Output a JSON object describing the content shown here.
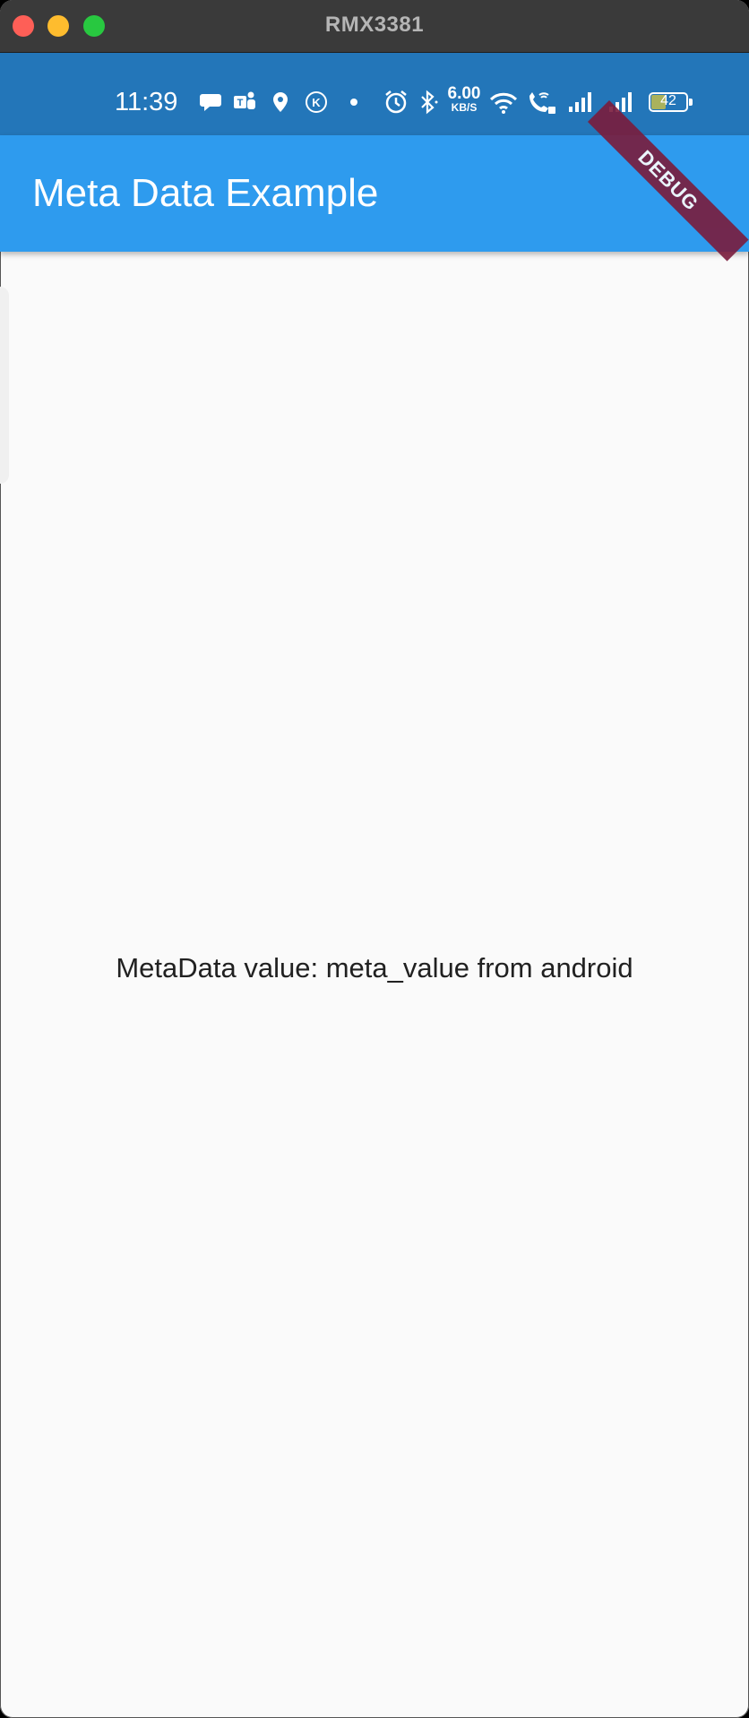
{
  "window": {
    "title": "RMX3381"
  },
  "status_bar": {
    "time": "11:39",
    "net_speed_value": "6.00",
    "net_speed_unit": "KB/S",
    "battery_level": "42",
    "icons": [
      "chat-bubble-icon",
      "teams-icon",
      "location-pin-icon",
      "k-circle-icon",
      "dot-icon",
      "alarm-icon",
      "bluetooth-icon",
      "wifi-icon",
      "wifi-call-icon",
      "signal-icon",
      "signal-icon",
      "battery-icon"
    ]
  },
  "debug_banner": {
    "label": "DEBUG"
  },
  "app_bar": {
    "title": "Meta Data Example"
  },
  "body": {
    "text": "MetaData value:  meta_value from android"
  },
  "colors": {
    "status_bar": "#2376b9",
    "app_bar": "#2e9bee",
    "background": "#fafafa",
    "debug_banner": "#7a1c3c"
  }
}
